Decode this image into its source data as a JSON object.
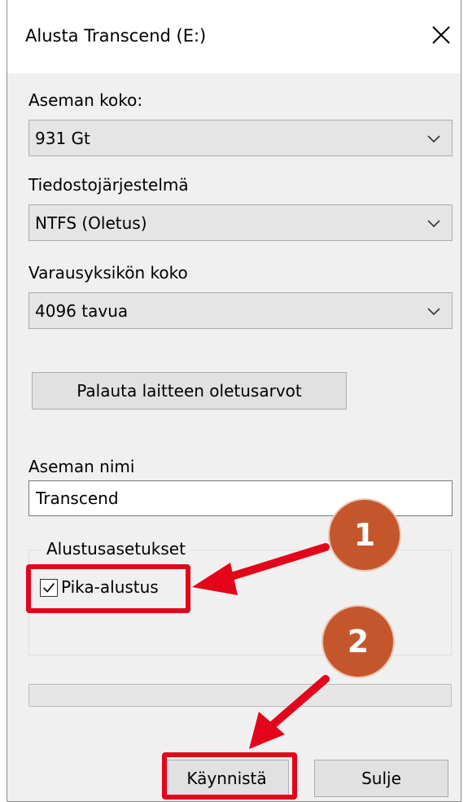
{
  "window": {
    "title": "Alusta Transcend (E:)"
  },
  "capacity": {
    "label": "Aseman koko:",
    "value": "931 Gt"
  },
  "file_system": {
    "label": "Tiedostojärjestelmä",
    "value": "NTFS (Oletus)"
  },
  "allocation_unit": {
    "label": "Varausyksikön koko",
    "value": "4096 tavua"
  },
  "restore_defaults": {
    "label": "Palauta laitteen oletusarvot"
  },
  "volume_label": {
    "label": "Aseman nimi",
    "value": "Transcend"
  },
  "format_options": {
    "legend": "Alustusasetukset",
    "quick_format": {
      "label": "Pika-alustus",
      "checked": true
    }
  },
  "progress": {
    "value": 0
  },
  "buttons": {
    "start": "Käynnistä",
    "close": "Sulje"
  },
  "annotations": [
    {
      "number": "1",
      "target": "quick_format"
    },
    {
      "number": "2",
      "target": "start_button"
    }
  ],
  "colors": {
    "highlight": "#e3061a",
    "badge": "#c5562c",
    "window_bg": "#f0f0f0"
  }
}
